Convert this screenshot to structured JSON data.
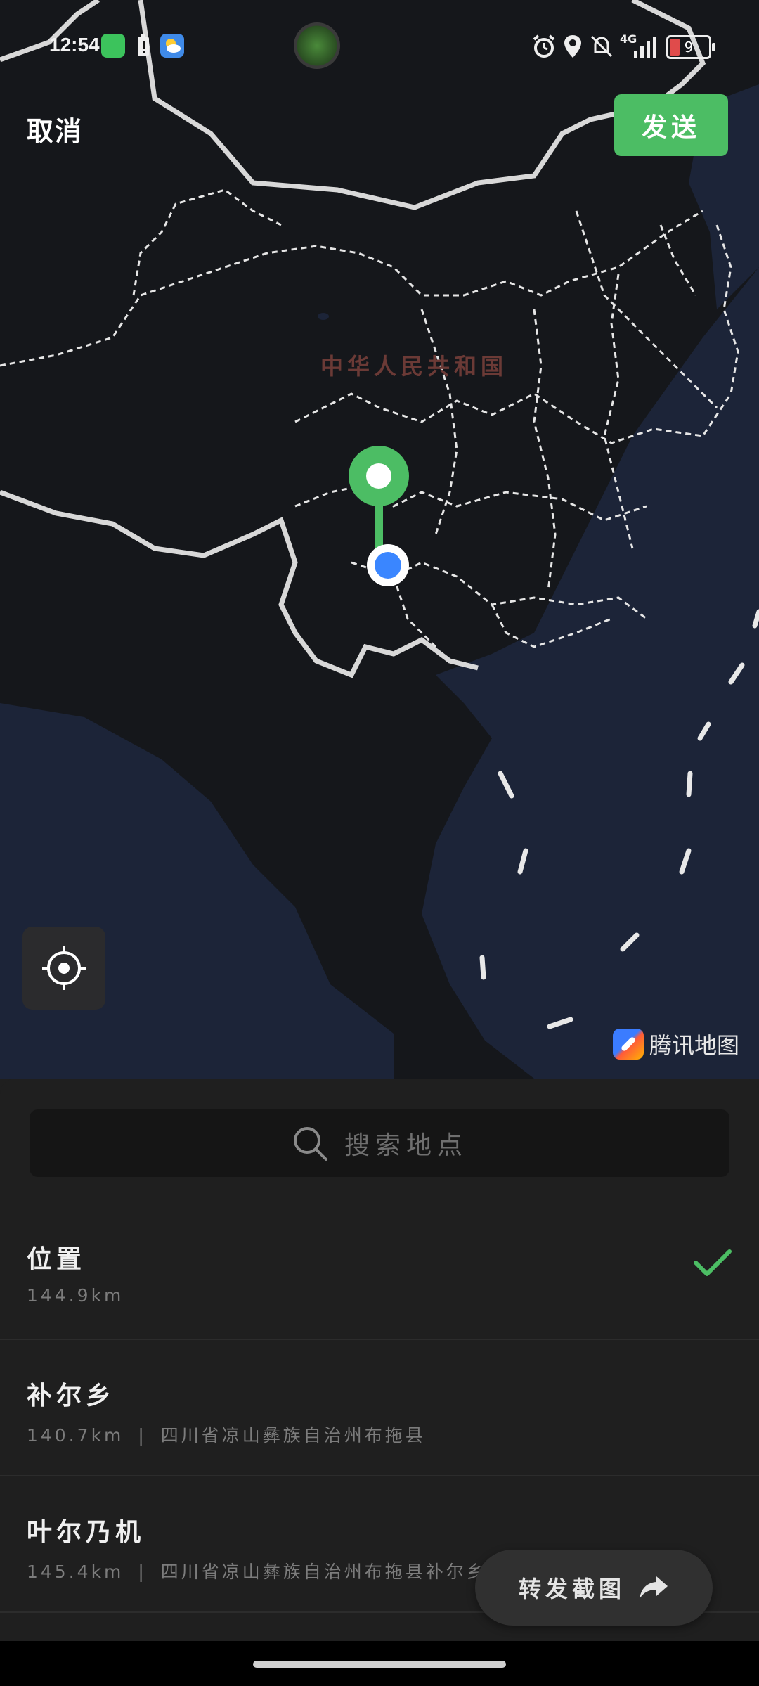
{
  "status_bar": {
    "time": "12:54",
    "network": "4G",
    "battery": "9"
  },
  "top_bar": {
    "cancel_label": "取消",
    "send_label": "发送"
  },
  "map": {
    "country_label": "中华人民共和国",
    "attribution": "腾讯地图",
    "pin_color": "#4cbd64",
    "current_location_color": "#3a86ff"
  },
  "search": {
    "placeholder": "搜索地点"
  },
  "locations": [
    {
      "title": "位置",
      "distance": "144.9km",
      "address": "",
      "selected": true
    },
    {
      "title": "补尔乡",
      "distance": "140.7km",
      "address": "四川省凉山彝族自治州布拖县",
      "selected": false
    },
    {
      "title": "叶尔乃机",
      "distance": "145.4km",
      "address": "四川省凉山彝族自治州布拖县补尔乡",
      "selected": false
    }
  ],
  "forward_button": {
    "label": "转发截图"
  },
  "colors": {
    "accent": "#4cbd64",
    "background": "#1f1f1f",
    "map_land": "#15171b",
    "map_sea": "#1c2438"
  }
}
